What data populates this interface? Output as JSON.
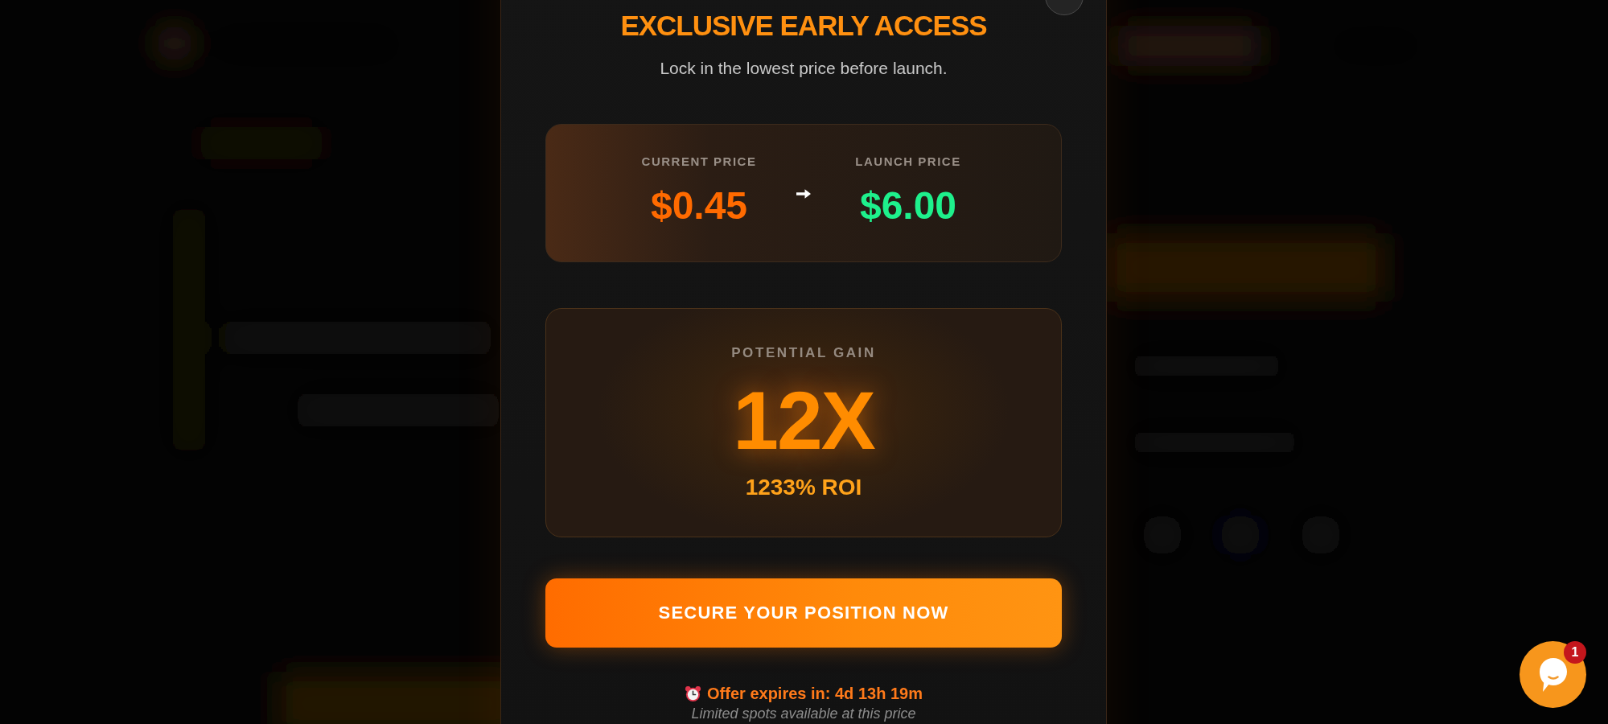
{
  "modal": {
    "title": "EXCLUSIVE EARLY ACCESS",
    "subtitle": "Lock in the lowest price before launch.",
    "price_card": {
      "prices": [
        {
          "label": "CURRENT PRICE",
          "value": "$0.45",
          "color": "#ff6a00"
        },
        {
          "label": "LAUNCH PRICE",
          "value": "$6.00",
          "color": "#1ef08c"
        }
      ]
    },
    "gain_card": {
      "label": "POTENTIAL GAIN",
      "multiplier": "12X",
      "roi": "1233% ROI"
    },
    "cta_button": {
      "label": "SECURE YOUR POSITION NOW"
    },
    "countdown": {
      "text": "Offer expires in: 4d 13h 19m"
    },
    "note": "Limited spots available at this price"
  },
  "chat_widget": {
    "badge": "1"
  }
}
